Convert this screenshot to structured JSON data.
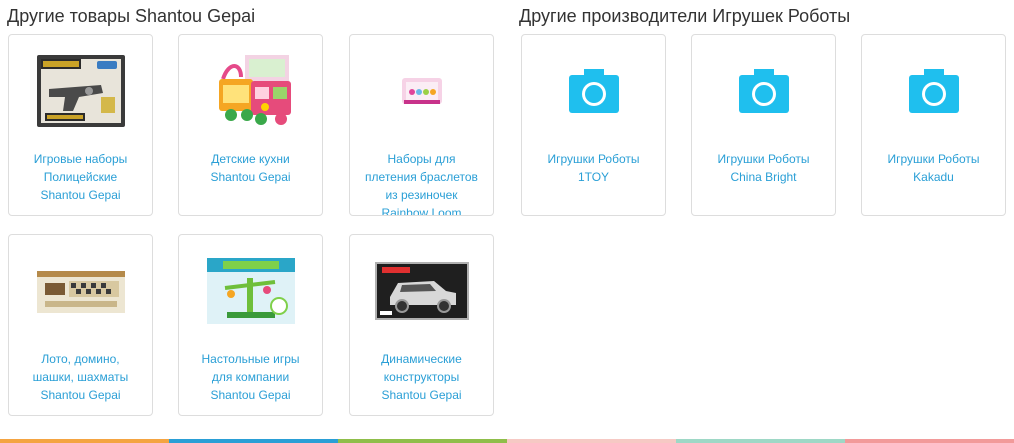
{
  "sections": {
    "own": {
      "title": "Другие товары Shantou Gepai",
      "items": [
        {
          "label": "Игровые наборы\nПолицейские\nShantou Gepai",
          "icon": "toy-gun-set-image"
        },
        {
          "label": "Детские кухни\nShantou Gepai",
          "icon": "toy-kitchen-image"
        },
        {
          "label": "Наборы для\nплетения браслетов\nиз резиночек\nRainbow Loom",
          "icon": "bracelet-kit-image"
        },
        {
          "label": "Лото, домино,\nшашки, шахматы\nShantou Gepai",
          "icon": "board-games-box-image"
        },
        {
          "label": "Настольные игры\nдля компании\nShantou Gepai",
          "icon": "balance-tree-game-image"
        },
        {
          "label": "Динамические\nконструкторы\nShantou Gepai",
          "icon": "car-constructor-box-image"
        }
      ]
    },
    "makers": {
      "title": "Другие производители Игрушек Роботы",
      "items": [
        {
          "label": "Игрушки Роботы\n1TOY",
          "icon": "camera-icon"
        },
        {
          "label": "Игрушки Роботы\nChina Bright",
          "icon": "camera-icon"
        },
        {
          "label": "Игрушки Роботы\nKakadu",
          "icon": "camera-icon"
        }
      ]
    }
  },
  "colors": {
    "link": "#2a9fd6",
    "camera": "#1fbfee",
    "stripe": [
      "#f4a442",
      "#2a9fd6",
      "#8fbe4a",
      "#f6c9c4",
      "#9ed8c6",
      "#f29a9a"
    ]
  }
}
